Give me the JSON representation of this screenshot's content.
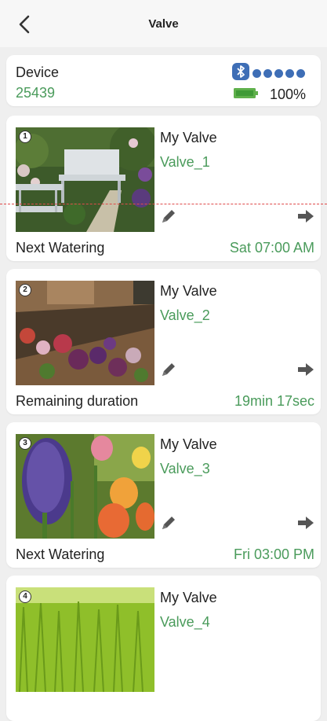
{
  "header": {
    "title": "Valve"
  },
  "device": {
    "label": "Device",
    "id": "25439",
    "battery_percent": "100%",
    "signal_level": 5,
    "accent": "#3e6eb6",
    "green": "#4a9b5b"
  },
  "valves": [
    {
      "number": "1",
      "name": "My Valve",
      "id": "Valve_1",
      "status_label": "Next Watering",
      "status_value": "Sat 07:00 AM"
    },
    {
      "number": "2",
      "name": "My Valve",
      "id": "Valve_2",
      "status_label": "Remaining duration",
      "status_value": "19min 17sec"
    },
    {
      "number": "3",
      "name": "My Valve",
      "id": "Valve_3",
      "status_label": "Next Watering",
      "status_value": "Fri 03:00 PM"
    },
    {
      "number": "4",
      "name": "My Valve",
      "id": "Valve_4"
    }
  ],
  "icons": {
    "back": "chevron-left-icon",
    "bluetooth": "bluetooth-icon",
    "battery": "battery-icon",
    "edit": "pencil-icon",
    "go": "arrow-right-icon"
  }
}
